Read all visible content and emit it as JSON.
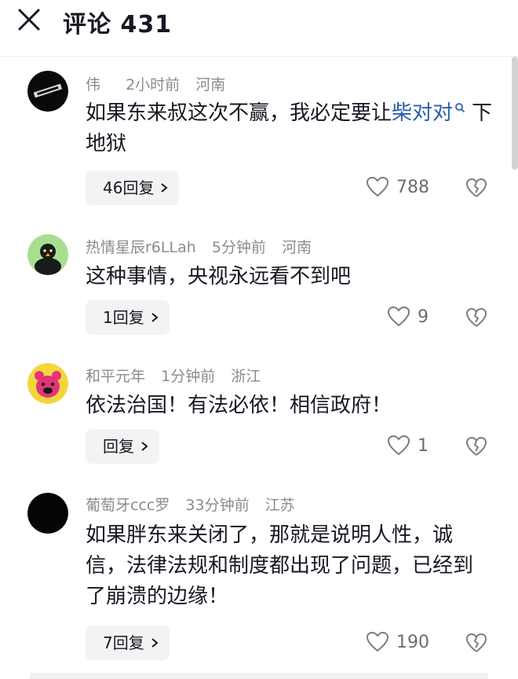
{
  "header": {
    "title": "评论 431"
  },
  "comments": [
    {
      "name": "伟",
      "time": "2小时前",
      "location": "河南",
      "text_before": "如果东来叔这次不赢，我必定要让",
      "link": "柴对对",
      "text_after": "下地狱",
      "reply_label": "46回复",
      "likes": "788"
    },
    {
      "name": "热情星辰r6LLah",
      "time": "5分钟前",
      "location": "河南",
      "text": "这种事情，央视永远看不到吧",
      "reply_label": "1回复",
      "likes": "9"
    },
    {
      "name": "和平元年",
      "time": "1分钟前",
      "location": "浙江",
      "text": "依法治国！有法必依！相信政府！",
      "reply_label": "回复",
      "likes": "1"
    },
    {
      "name": "葡萄牙ccc罗",
      "time": "33分钟前",
      "location": "江苏",
      "text": "如果胖东来关闭了，那就是说明人性，诚信，法律法规和制度都出现了问题，已经到了崩溃的边缘！",
      "reply_label": "7回复",
      "likes": "190"
    }
  ],
  "colors": {
    "link": "#2b5fa8",
    "meta": "#8a8b91",
    "reply_bg": "#f3f3f4"
  }
}
